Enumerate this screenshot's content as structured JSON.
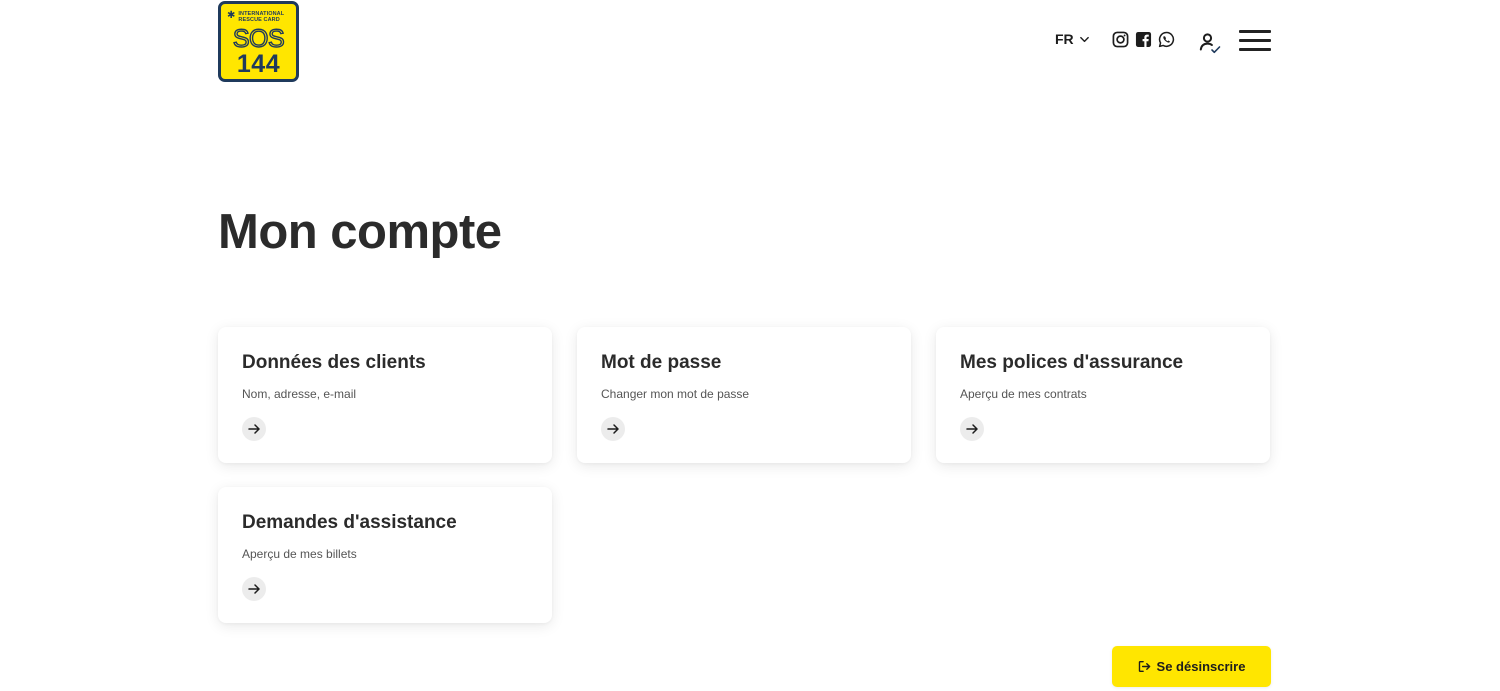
{
  "header": {
    "logo": {
      "small_text": "INTERNATIONAL\nRESCUE CARD",
      "line1": "SOS",
      "line2": "144"
    },
    "language": "FR",
    "icons": [
      "instagram-icon",
      "facebook-icon",
      "whatsapp-icon",
      "user-check-icon",
      "hamburger-menu-icon"
    ]
  },
  "main": {
    "title": "Mon compte",
    "cards": [
      {
        "title": "Données des clients",
        "subtitle": "Nom, adresse, e-mail"
      },
      {
        "title": "Mot de passe",
        "subtitle": "Changer mon mot de passe"
      },
      {
        "title": "Mes polices d'assurance",
        "subtitle": "Aperçu de mes contrats"
      },
      {
        "title": "Demandes d'assistance",
        "subtitle": "Aperçu de mes billets"
      }
    ]
  },
  "footer": {
    "unsubscribe_label": "Se désinscrire"
  },
  "colors": {
    "brand_yellow": "#ffe600",
    "brand_navy": "#1f3a5c",
    "text_dark": "#2b2b2b"
  }
}
